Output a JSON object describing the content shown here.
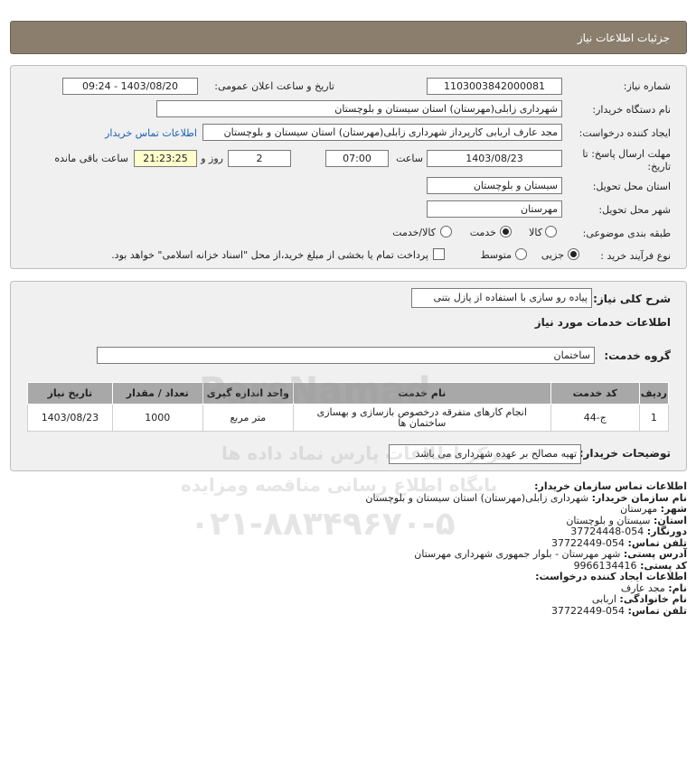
{
  "header": {
    "title": "جزئیات اطلاعات نیاز"
  },
  "form": {
    "need_number_label": "شماره نیاز:",
    "need_number": "1103003842000081",
    "announce_label": "تاریخ و ساعت اعلان عمومی:",
    "announce_value": "1403/08/20 - 09:24",
    "buyer_org_label": "نام دستگاه خریدار:",
    "buyer_org": "شهرداری زابلی(مهرستان) استان سیستان و بلوچستان",
    "creator_label": "ایجاد کننده درخواست:",
    "creator": "مجد عارف اربابی کارپرداز شهرداری زابلی(مهرستان) استان سیستان و بلوچستان",
    "contact_link": "اطلاعات تماس خریدار",
    "deadline_label_1": "مهلت ارسال پاسخ: تا",
    "deadline_label_2": "تاریخ:",
    "deadline_date": "1403/08/23",
    "time_label": "ساعت",
    "deadline_time": "07:00",
    "days_value": "2",
    "days_label": "روز و",
    "remaining_time": "21:23:25",
    "remaining_label": "ساعت باقی مانده",
    "province_label": "استان محل تحویل:",
    "province": "سیستان و بلوچستان",
    "city_label": "شهر محل تحویل:",
    "city": "مهرستان",
    "category_label": "طبقه بندی موضوعی:",
    "category_options": [
      "کالا",
      "خدمت",
      "کالا/خدمت"
    ],
    "category_selected": "خدمت",
    "process_label": "نوع فرآیند خرید :",
    "process_options": [
      "جزیی",
      "متوسط"
    ],
    "process_selected": "جزیی",
    "payment_note": "پرداخت تمام یا بخشی از مبلغ خرید،از محل \"اسناد خزانه اسلامی\" خواهد بود."
  },
  "details": {
    "summary_label": "شرح کلی نیاز:",
    "summary": "پیاده رو سازی با استفاده از پازل بتنی",
    "services_title": "اطلاعات خدمات مورد نیاز",
    "group_label": "گروه خدمت:",
    "group_value": "ساختمان",
    "table": {
      "headers": [
        "ردیف",
        "کد خدمت",
        "نام خدمت",
        "واحد اندازه گیری",
        "تعداد / مقدار",
        "تاریخ نیاز"
      ],
      "rows": [
        {
          "row": "1",
          "code": "ج-44",
          "name": "انجام کارهای متفرقه درخصوص بازسازی و بهسازی ساختمان ها",
          "unit": "متر مربع",
          "qty": "1000",
          "date": "1403/08/23"
        }
      ]
    },
    "buyer_notes_label": "توضیحات خریدار:",
    "buyer_notes": "تهیه مصالح بر عهده شهرداری می باشد"
  },
  "contact": {
    "title": "اطلاعات تماس سازمان خریدار:",
    "org_label": "نام سازمان خریدار:",
    "org": "شهرداری زابلی(مهرستان) استان سیستان و بلوچستان",
    "city_label": "شهر:",
    "city": "مهرستان",
    "province_label": "استان:",
    "province": "سیستان و بلوچستان",
    "fax_label": "دورنگار:",
    "fax": "054-37724448",
    "phone_label": "تلفن تماس:",
    "phone": "054-37722449",
    "address_label": "آدرس پستی:",
    "address": "شهر مهرستان - بلوار جمهوری شهرداری مهرستان",
    "postal_label": "کد پستی:",
    "postal": "9966134416",
    "creator_title": "اطلاعات ایجاد کننده درخواست:",
    "name_label": "نام:",
    "name": "مجد عارف",
    "family_label": "نام خانوادگی:",
    "family": "اربابی",
    "creator_phone_label": "تلفن تماس:",
    "creator_phone": "054-37722449"
  },
  "watermark": {
    "line1": "ParsNamad",
    "line2": "مرکز اطلاعات پارس نماد داده ها",
    "line3": "پایگاه اطلاع رسانی مناقصه ومزایده",
    "phone": "۰۲۱-۸۸۳۴۹۶۷۰-۵"
  }
}
